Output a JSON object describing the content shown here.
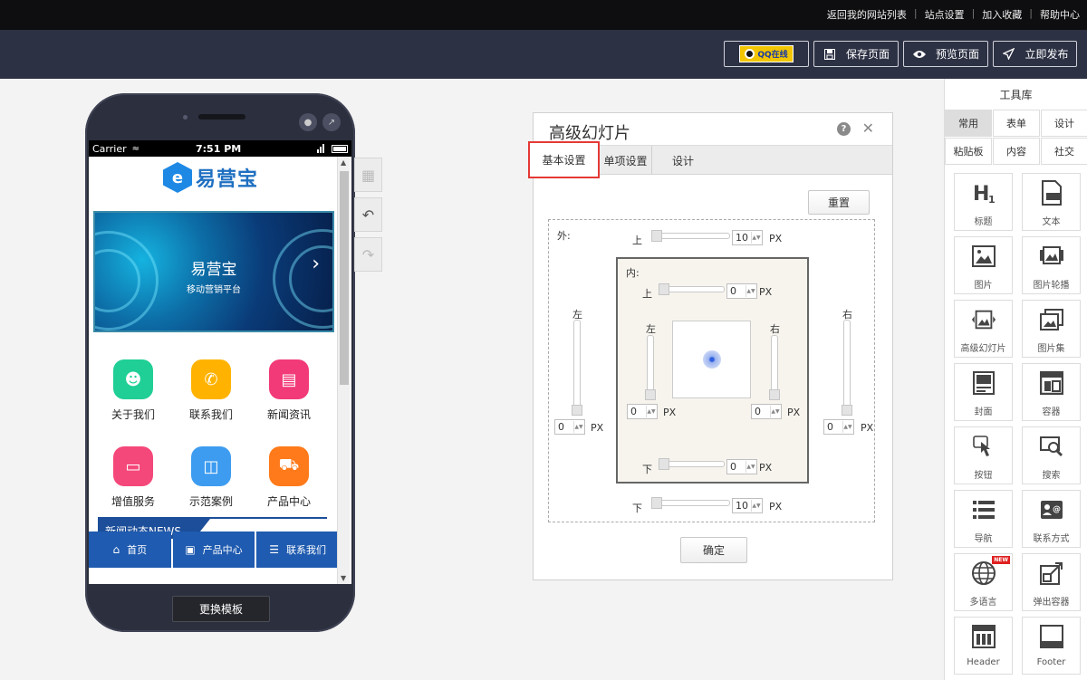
{
  "top_links": [
    "返回我的网站列表",
    "站点设置",
    "加入收藏",
    "帮助中心"
  ],
  "toolbar": {
    "qq_badge": "QQ在线",
    "save_label": "保存页面",
    "preview_label": "预览页面",
    "publish_label": "立即发布"
  },
  "phone": {
    "carrier": "Carrier",
    "time": "7:51 PM",
    "brand": "易营宝",
    "banner_title": "易营宝",
    "banner_subtitle": "移动营销平台",
    "grid": [
      {
        "label": "关于我们",
        "icon": "people-icon",
        "color": "#1fcf95"
      },
      {
        "label": "联系我们",
        "icon": "phone-icon",
        "color": "#ffb300"
      },
      {
        "label": "新闻资讯",
        "icon": "news-icon",
        "color": "#f23a79"
      },
      {
        "label": "增值服务",
        "icon": "laptop-icon",
        "color": "#f5487a"
      },
      {
        "label": "示范案例",
        "icon": "briefcase-icon",
        "color": "#3d9cf0"
      },
      {
        "label": "产品中心",
        "icon": "cart-icon",
        "color": "#ff7a1a"
      }
    ],
    "news_title": "新闻动态NEWS",
    "nav": [
      {
        "label": "首页",
        "icon": "home-icon"
      },
      {
        "label": "产品中心",
        "icon": "product-icon"
      },
      {
        "label": "联系我们",
        "icon": "list-icon"
      }
    ],
    "switch_template": "更换模板"
  },
  "dialog": {
    "title": "高级幻灯片",
    "tabs": [
      "基本设置",
      "单项设置",
      "设计"
    ],
    "reset_label": "重置",
    "outer_label": "外:",
    "inner_label": "内:",
    "top": "上",
    "bottom": "下",
    "left": "左",
    "right": "右",
    "unit": "PX",
    "outer": {
      "top": "10",
      "bottom": "10",
      "left": "0",
      "right": "0"
    },
    "inner": {
      "top": "0",
      "bottom": "0",
      "left": "0",
      "right": "0"
    },
    "ok_label": "确定"
  },
  "library": {
    "title": "工具库",
    "tabs": [
      "常用",
      "表单",
      "设计",
      "粘贴板",
      "内容",
      "社交"
    ],
    "tools": [
      {
        "label": "标题",
        "icon": "heading-icon"
      },
      {
        "label": "文本",
        "icon": "text-icon"
      },
      {
        "label": "图片",
        "icon": "image-icon"
      },
      {
        "label": "图片轮播",
        "icon": "carousel-icon"
      },
      {
        "label": "高级幻灯片",
        "icon": "slideshow-icon"
      },
      {
        "label": "图片集",
        "icon": "gallery-icon"
      },
      {
        "label": "封面",
        "icon": "cover-icon"
      },
      {
        "label": "容器",
        "icon": "container-icon"
      },
      {
        "label": "按钮",
        "icon": "button-icon"
      },
      {
        "label": "搜索",
        "icon": "search-icon"
      },
      {
        "label": "导航",
        "icon": "nav-icon"
      },
      {
        "label": "联系方式",
        "icon": "contact-icon"
      },
      {
        "label": "多语言",
        "icon": "globe-icon"
      },
      {
        "label": "弹出容器",
        "icon": "popup-icon"
      },
      {
        "label": "Header",
        "icon": "header-icon"
      },
      {
        "label": "Footer",
        "icon": "footer-icon"
      }
    ],
    "new_badge": "NEW"
  }
}
